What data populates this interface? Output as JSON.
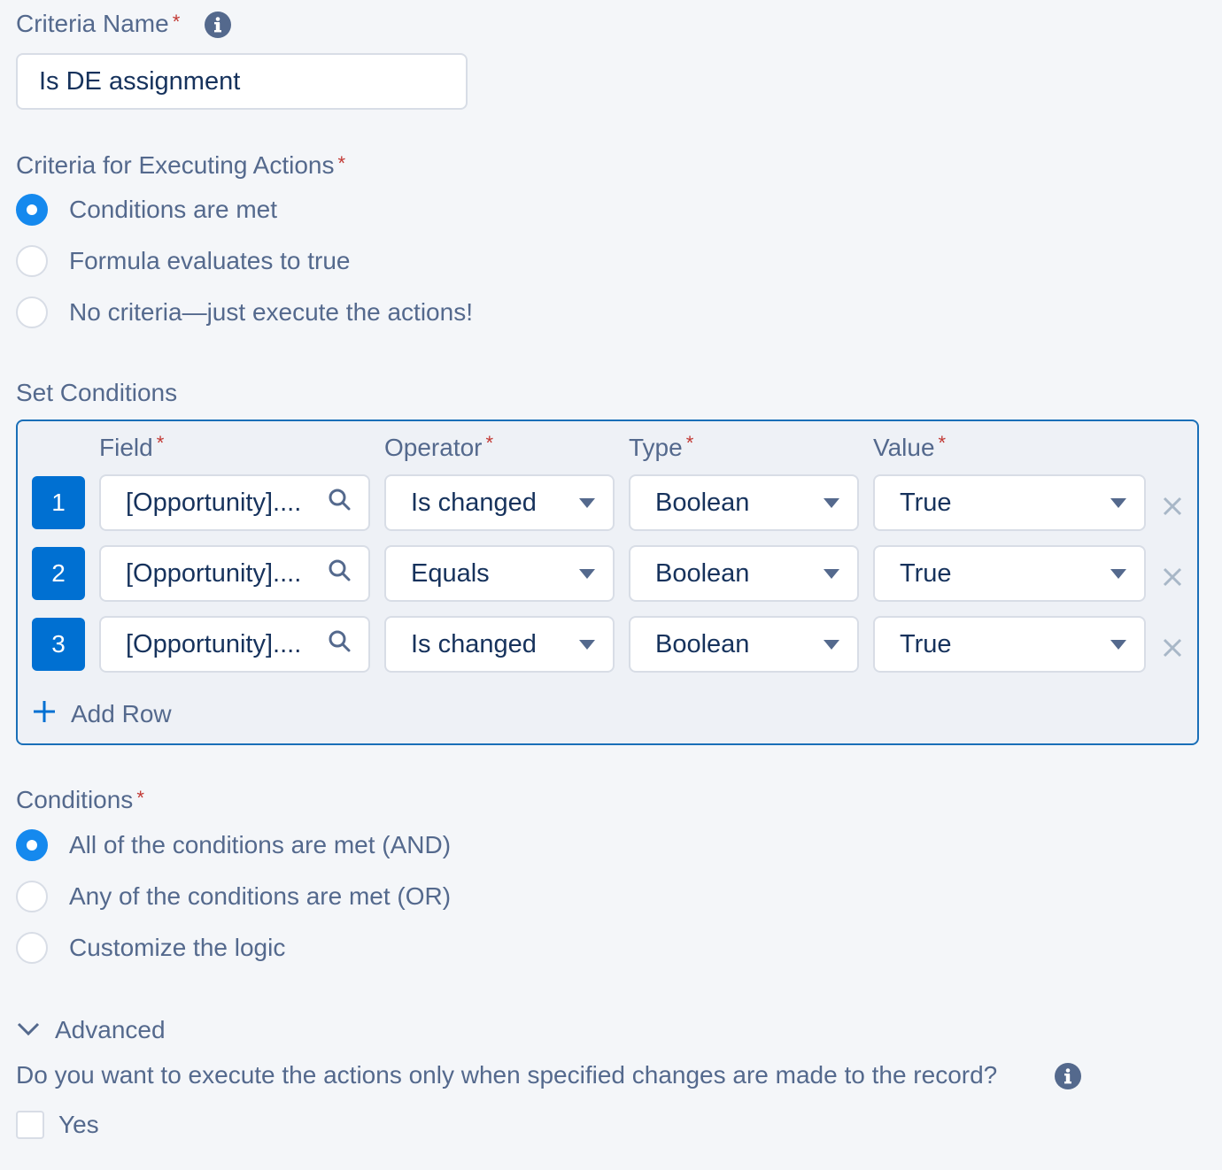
{
  "criteria_name": {
    "label": "Criteria Name",
    "required_mark": "*",
    "value": "Is DE assignment",
    "info_icon": "info-icon"
  },
  "executing": {
    "label": "Criteria for Executing Actions",
    "required_mark": "*",
    "options": [
      {
        "label": "Conditions are met",
        "checked": true
      },
      {
        "label": "Formula evaluates to true",
        "checked": false
      },
      {
        "label": "No criteria—just execute the actions!",
        "checked": false
      }
    ]
  },
  "set_conditions": {
    "title": "Set Conditions",
    "columns": {
      "field": "Field",
      "operator": "Operator",
      "type": "Type",
      "value": "Value",
      "required_mark": "*"
    },
    "rows": [
      {
        "num": "1",
        "field": "[Opportunity]....",
        "operator": "Is changed",
        "type": "Boolean",
        "value": "True"
      },
      {
        "num": "2",
        "field": "[Opportunity]....",
        "operator": "Equals",
        "type": "Boolean",
        "value": "True"
      },
      {
        "num": "3",
        "field": "[Opportunity]....",
        "operator": "Is changed",
        "type": "Boolean",
        "value": "True"
      }
    ],
    "add_row": "Add Row"
  },
  "conditions": {
    "label": "Conditions",
    "required_mark": "*",
    "options": [
      {
        "label": "All of the conditions are met (AND)",
        "checked": true
      },
      {
        "label": "Any of the conditions are met (OR)",
        "checked": false
      },
      {
        "label": "Customize the logic",
        "checked": false
      }
    ]
  },
  "advanced": {
    "label": "Advanced",
    "question": "Do you want to execute the actions only when specified changes are made to the record?",
    "checkbox_label": "Yes",
    "checked": false
  },
  "colors": {
    "accent": "#1589ee",
    "row_badge": "#0070d2",
    "box_border": "#1a6fb8",
    "required": "#c23934",
    "label_text": "#54698d"
  }
}
